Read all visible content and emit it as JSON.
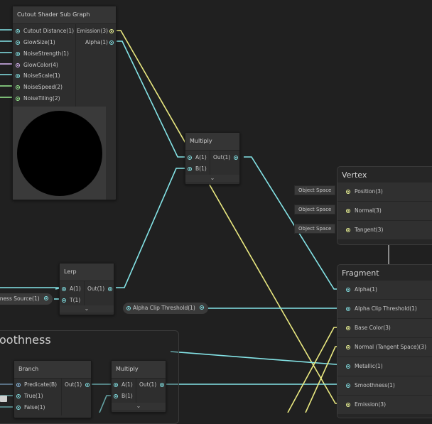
{
  "colors": {
    "background": "#202020",
    "wire_float": "#84e4e7",
    "wire_vector": "#eae980",
    "wire_color": "#eae980",
    "port_float": "#84e4e7",
    "port_vector3": "#f6ff9a",
    "port_vector2": "#9aef92",
    "port_color": "#dcb8f7",
    "port_bool": "#8fbfe6"
  },
  "subgraph": {
    "title": "Cutout Shader Sub Graph",
    "inputs": [
      "Cutout Distance(1)",
      "GlowSize(1)",
      "NoiseStrength(1)",
      "GlowColor(4)",
      "NoiseScale(1)",
      "NoiseSpeed(2)",
      "NoiseTiling(2)"
    ],
    "outputs": [
      "Emission(3)",
      "Alpha(1)"
    ]
  },
  "multiply_top": {
    "title": "Multiply",
    "inputs": [
      "A(1)",
      "B(1)"
    ],
    "output": "Out(1)"
  },
  "lerp": {
    "title": "Lerp",
    "inputs": [
      "A(1)",
      "T(1)"
    ],
    "output": "Out(1)"
  },
  "smoothness_source": "thness Source(1)",
  "alpha_clip_property": "Alpha Clip Threshold(1)",
  "vertex": {
    "title": "Vertex",
    "blocks": [
      "Position(3)",
      "Normal(3)",
      "Tangent(3)"
    ],
    "space_label": "Object Space"
  },
  "fragment": {
    "title": "Fragment",
    "blocks": [
      "Alpha(1)",
      "Alpha Clip Threshold(1)",
      "Base Color(3)",
      "Normal (Tangent Space)(3)",
      "Metallic(1)",
      "Smoothness(1)",
      "Emission(3)"
    ]
  },
  "group": {
    "title": "oothness"
  },
  "branch": {
    "title": "Branch",
    "inputs": [
      "Predicate(B)",
      "True(1)",
      "False(1)"
    ],
    "output": "Out(1)"
  },
  "multiply_bottom": {
    "title": "Multiply",
    "inputs": [
      "A(1)",
      "B(1)"
    ],
    "output": "Out(1)"
  },
  "chevron": "⌄"
}
